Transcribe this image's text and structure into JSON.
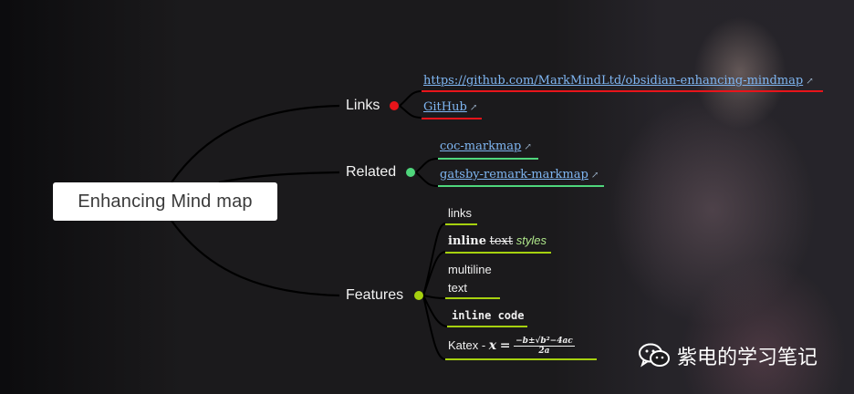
{
  "root": {
    "label": "Enhancing Mind map"
  },
  "branches": {
    "links": {
      "label": "Links",
      "dot_color": "#e8141a",
      "line_color": "#e8141a",
      "items": [
        {
          "text": "https://github.com/MarkMindLtd/obsidian-enhancing-mindmap"
        },
        {
          "text": "GitHub"
        }
      ]
    },
    "related": {
      "label": "Related",
      "dot_color": "#4fd67c",
      "line_color": "#4fd67c",
      "items": [
        {
          "text": "coc-markmap"
        },
        {
          "text": "gatsby-remark-markmap"
        }
      ]
    },
    "features": {
      "label": "Features",
      "dot_color": "#a6d10f",
      "line_color": "#a6d10f",
      "items": {
        "links": "links",
        "inline_bold": "inline",
        "inline_strike": "text",
        "inline_italic": "styles",
        "multiline_1": "multiline",
        "multiline_2": "text",
        "code": "inline code",
        "katex_prefix": "Katex - ",
        "katex_var": "x",
        "katex_eq": "=",
        "katex_num": "−b±√b²−4ac",
        "katex_den": "2a"
      }
    }
  },
  "external_link_icon": "external-link-icon",
  "watermark": {
    "icon": "wechat-icon",
    "text": "紫电的学习笔记"
  },
  "colors": {
    "background": "#1b1a1c",
    "root_box": "#ffffff",
    "link": "#7fb6f2"
  }
}
